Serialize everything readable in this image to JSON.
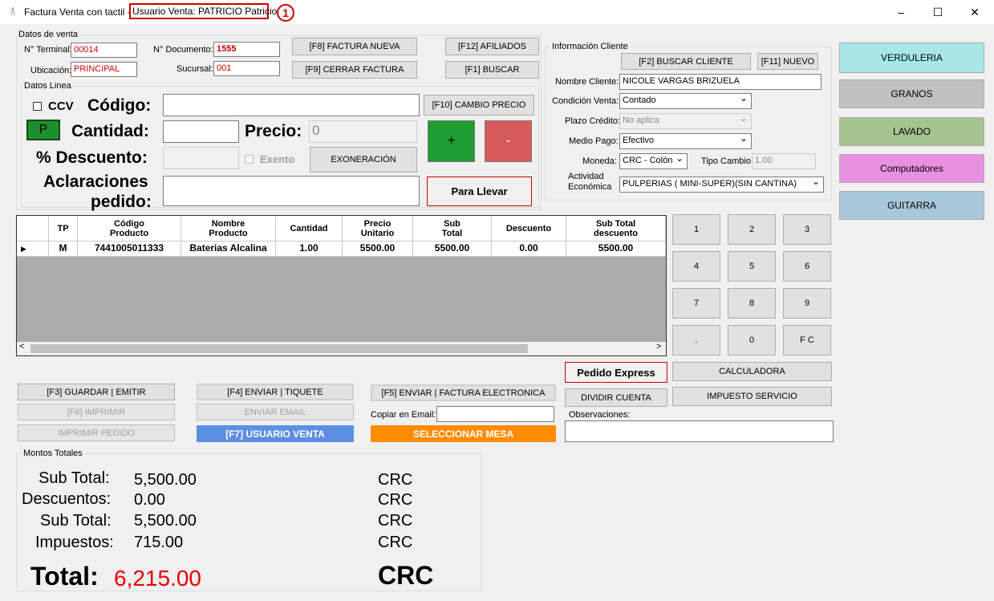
{
  "window": {
    "title": "Factura Venta con tactil -",
    "user_label": "Usuario Venta: PATRICIO Patricio",
    "marker": "1",
    "minimize": "–",
    "maximize": "☐",
    "close": "✕"
  },
  "datos_venta": {
    "group_label": "Datos de venta",
    "terminal_label": "N° Terminal:",
    "terminal_value": "00014",
    "documento_label": "N° Documento:",
    "documento_value": "1555",
    "ubicacion_label": "Ubicación:",
    "ubicacion_value": "PRINCIPAL",
    "sucursal_label": "Sucursal:",
    "sucursal_value": "001"
  },
  "buttons": {
    "factura_nueva": "[F8] FACTURA NUEVA",
    "cerrar_factura": "[F9] CERRAR FACTURA",
    "afiliados": "[F12] AFILIADOS",
    "buscar": "[F1] BUSCAR",
    "cambio_precio": "[F10] CAMBIO PRECIO",
    "plus": "+",
    "minus": "-",
    "exoneracion": "EXONERACIÓN",
    "para_llevar": "Para Llevar",
    "guardar": "[F3] GUARDAR | EMITIR",
    "imprimir": "[F6] IMPRIMIR",
    "imprimir_pedido": "IMPRIMIR PEDIDO",
    "enviar_tiquete": "[F4] ENVIAR | TIQUETE",
    "enviar_email": "ENVIAR EMAIL",
    "usuario_venta": "[F7] USUARIO VENTA",
    "enviar_factura": "[F5] ENVIAR | FACTURA ELECTRONICA",
    "seleccionar_mesa": "SELECCIONAR MESA",
    "pedido_express": "Pedido Express",
    "dividir_cuenta": "DIVIDIR CUENTA",
    "calculadora": "CALCULADORA",
    "impuesto_servicio": "IMPUESTO SERVICIO"
  },
  "datos_linea": {
    "group_label": "Datos Linea",
    "ccv_label": "CCV",
    "p_label": "P",
    "codigo_label": "Código:",
    "cantidad_label": "Cantidad:",
    "precio_label": "Precio:",
    "precio_value": "0",
    "descuento_label": "% Descuento:",
    "exento_label": "Exento",
    "aclaraciones_label_1": "Aclaraciones",
    "aclaraciones_label_2": "pedido:"
  },
  "cliente": {
    "group_label": "Información Cliente",
    "buscar_cliente": "[F2] BUSCAR CLIENTE",
    "nuevo": "[F11] NUEVO",
    "nombre_label": "Nombre Cliente:",
    "nombre_value": "NICOLE VARGAS BRIZUELA",
    "condicion_label": "Condición Venta:",
    "condicion_value": "Contado",
    "plazo_label": "Plazo Crédito:",
    "plazo_value": "No aplica",
    "medio_label": "Medio Pago:",
    "medio_value": "Efectivo",
    "moneda_label": "Moneda:",
    "moneda_value": "CRC - Colón",
    "tipo_cambio_label": "Tipo Cambio:",
    "tipo_cambio_value": "1.00",
    "actividad_label_1": "Actividad",
    "actividad_label_2": "Económica",
    "actividad_value": "PULPERIAS ( MINI-SUPER)(SIN CANTINA)"
  },
  "categories": [
    {
      "label": "VERDULERIA",
      "color": "#a6e8e6"
    },
    {
      "label": "GRANOS",
      "color": "#c0c0c0"
    },
    {
      "label": "LAVADO",
      "color": "#a5c48f"
    },
    {
      "label": "Computadores",
      "color": "#e990e1"
    },
    {
      "label": "GUITARRA",
      "color": "#a8c8d9"
    }
  ],
  "table": {
    "headers": [
      [
        "TP",
        ""
      ],
      [
        "Código",
        "Producto"
      ],
      [
        "Nombre",
        "Producto"
      ],
      [
        "Cantidad",
        ""
      ],
      [
        "Precio",
        "Unitario"
      ],
      [
        "Sub",
        "Total"
      ],
      [
        "Descuento",
        ""
      ],
      [
        "Sub Total",
        "descuento"
      ]
    ],
    "rows": [
      [
        "M",
        "7441005011333",
        "Baterias Alcalina",
        "1.00",
        "5500.00",
        "5500.00",
        "0.00",
        "5500.00"
      ]
    ]
  },
  "numpad": [
    "1",
    "2",
    "3",
    "4",
    "5",
    "6",
    "7",
    "8",
    "9",
    ".",
    "0",
    "F C"
  ],
  "email": {
    "label": "Copiar en Email:",
    "value": ""
  },
  "observaciones": {
    "label": "Observaciones:",
    "value": ""
  },
  "montos": {
    "group_label": "Montos Totales",
    "rows": [
      {
        "label": "Sub Total:",
        "value": "5,500.00",
        "currency": "CRC"
      },
      {
        "label": "Descuentos:",
        "value": "0.00",
        "currency": "CRC"
      },
      {
        "label": "Sub Total:",
        "value": "5,500.00",
        "currency": "CRC"
      },
      {
        "label": "Impuestos:",
        "value": "715.00",
        "currency": "CRC"
      }
    ],
    "total_label": "Total:",
    "total_value": "6,215.00",
    "total_currency": "CRC"
  }
}
